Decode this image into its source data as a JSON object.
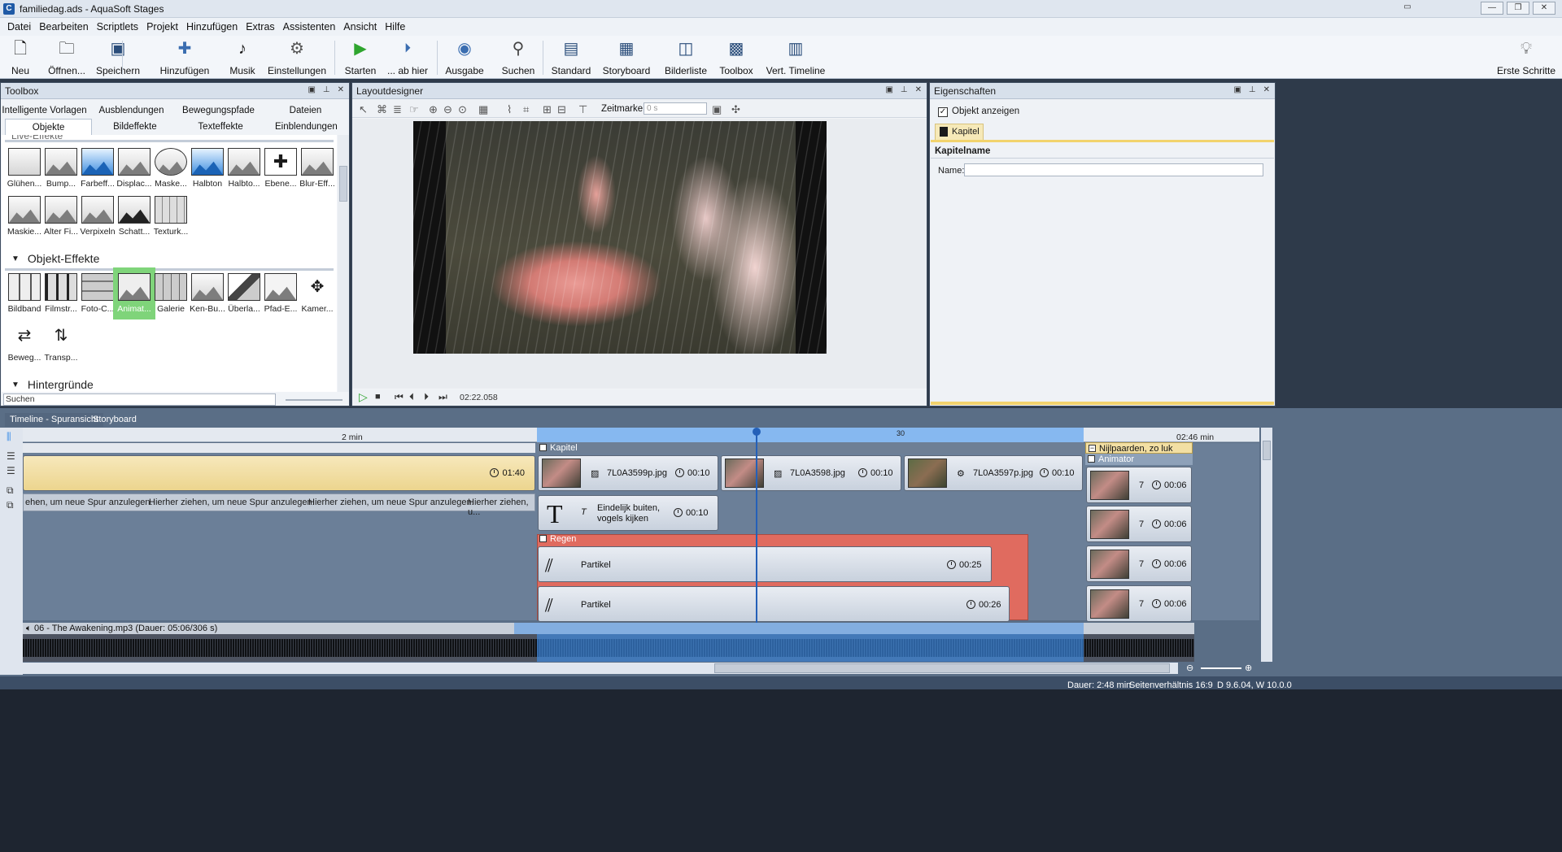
{
  "window": {
    "title": "familiedag.ads - AquaSoft Stages",
    "controls": [
      "—",
      "❐",
      "✕"
    ]
  },
  "menu": [
    "Datei",
    "Bearbeiten",
    "Scriptlets",
    "Projekt",
    "Hinzufügen",
    "Extras",
    "Assistenten",
    "Ansicht",
    "Hilfe"
  ],
  "toolbar": {
    "buttons": [
      "Neu",
      "Öffnen...",
      "Speichern",
      "Hinzufügen",
      "Musik",
      "Einstellungen",
      "Starten",
      "... ab hier",
      "Ausgabe",
      "Suchen",
      "Standard",
      "Storyboard",
      "Bilderliste",
      "Toolbox",
      "Vert. Timeline"
    ],
    "right_button": "Erste Schritte"
  },
  "toolbox": {
    "title": "Toolbox",
    "tabs_row1": [
      "Intelligente Vorlagen",
      "Ausblendungen",
      "Bewegungspfade",
      "Dateien"
    ],
    "tabs_row2": [
      "Objekte",
      "Bildeffekte",
      "Texteffekte",
      "Einblendungen"
    ],
    "active_tab": "Objekte",
    "live_effects_partial": "Live-Effekte",
    "live_effects": [
      "Glühen...",
      "Bump...",
      "Farbeff...",
      "Displac...",
      "Maske...",
      "Halbton",
      "Halbto...",
      "Ebene...",
      "Blur-Eff...",
      "Maskie...",
      "Alter Fi...",
      "Verpixeln",
      "Schatt...",
      "Texturk..."
    ],
    "object_effects_title": "Objekt-Effekte",
    "object_effects": [
      "Bildband",
      "Filmstr...",
      "Foto-C...",
      "Animat...",
      "Galerie",
      "Ken-Bu...",
      "Überla...",
      "Pfad-E...",
      "Kamer...",
      "Beweg...",
      "Transp..."
    ],
    "selected_effect": "Animat...",
    "backgrounds_title": "Hintergründe",
    "search_placeholder": "Suchen"
  },
  "layoutdesigner": {
    "title": "Layoutdesigner",
    "zeitmarke_label": "Zeitmarke:",
    "zeitmarke_value": "0 s",
    "time": "02:22.058"
  },
  "properties": {
    "title": "Eigenschaften",
    "checkbox_label": "Objekt anzeigen",
    "tab": "Kapitel",
    "section": "Kapitelname",
    "name_label": "Name:",
    "name_value": ""
  },
  "timeline": {
    "tabs": [
      "Timeline - Spuransicht",
      "Storyboard"
    ],
    "ruler_label_left": "2 min",
    "ruler_label_30": "30",
    "ruler_label_right": "02:46 min",
    "left_clip_duration": "01:40",
    "drop_hints": [
      "ehen, um neue Spur anzulegen.",
      "Hierher ziehen, um neue Spur anzulegen.",
      "Hierher ziehen, um neue Spur anzulegen.",
      "Hierher ziehen, u..."
    ],
    "kapitel_label": "Kapitel",
    "clips": [
      {
        "name": "7L0A3599p.jpg",
        "duration": "00:10"
      },
      {
        "name": "7L0A3598.jpg",
        "duration": "00:10"
      },
      {
        "name": "7L0A3597p.jpg",
        "duration": "00:10"
      }
    ],
    "text_clip": {
      "line1": "Eindelijk buiten,",
      "line2": "vogels kijken",
      "duration": "00:10"
    },
    "regen_label": "Regen",
    "particles": [
      {
        "name": "Partikel",
        "duration": "00:25"
      },
      {
        "name": "Partikel",
        "duration": "00:26"
      }
    ],
    "right_group": "Nijlpaarden, zo luk",
    "animator_label": "Animator",
    "animator_items": [
      {
        "count": "7",
        "duration": "00:06"
      },
      {
        "count": "7",
        "duration": "00:06"
      },
      {
        "count": "7",
        "duration": "00:06"
      },
      {
        "count": "7",
        "duration": "00:06"
      }
    ],
    "audio_label": "06 - The Awakening.mp3 (Dauer: 05:06/306 s)"
  },
  "status": {
    "duration": "Dauer: 2:48 min",
    "aspect": "Seitenverhältnis 16:9",
    "version": "D 9.6.04, W 10.0.0"
  },
  "colors": {
    "accent_blue": "#3d8ee8",
    "selection_green": "#7fd47a",
    "regen_red": "#e06b5f",
    "chapter_yellow": "#f2dfa3"
  }
}
